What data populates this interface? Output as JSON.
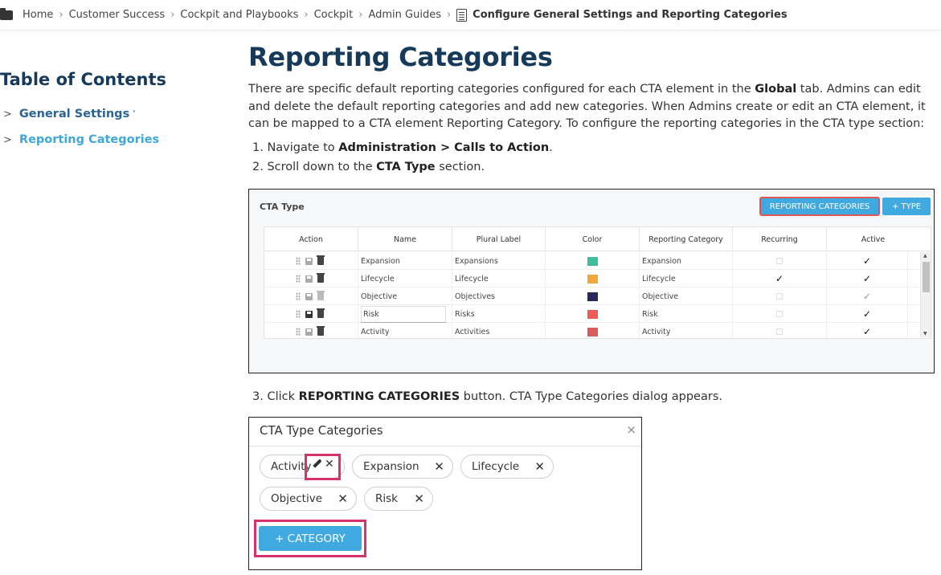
{
  "breadcrumb": {
    "items": [
      "Home",
      "Customer Success",
      "Cockpit and Playbooks",
      "Cockpit",
      "Admin Guides"
    ],
    "current": "Configure General Settings and Reporting Categories"
  },
  "toc": {
    "title": "Table of Contents",
    "items": [
      {
        "label": "General Settings",
        "expandable": true
      },
      {
        "label": "Reporting Categories",
        "active": true
      }
    ]
  },
  "main": {
    "heading": "Reporting Categories",
    "intro_1": "There are specific default reporting categories configured for each CTA element in the ",
    "intro_bold": "Global",
    "intro_2": " tab. Admins can edit and delete the default reporting categories and add new categories. When Admins create or edit an CTA element, it can be mapped to a CTA element Reporting Category. To configure the reporting categories in the CTA type section:",
    "step1_a": "1. Navigate to ",
    "step1_bold": "Administration > Calls to Action",
    "step1_b": ".",
    "step2_a": "2. Scroll down to the ",
    "step2_bold": "CTA Type",
    "step2_b": " section.",
    "step3_a": "3. Click ",
    "step3_bold": "REPORTING CATEGORIES",
    "step3_b": " button. CTA Type Categories dialog appears."
  },
  "cta_type_panel": {
    "title": "CTA Type",
    "reporting_button": "REPORTING CATEGORIES",
    "type_button": "+ TYPE",
    "columns": [
      "Action",
      "Name",
      "Plural Label",
      "Color",
      "Reporting Category",
      "Recurring",
      "Active"
    ],
    "rows": [
      {
        "name": "Expansion",
        "plural": "Expansions",
        "color": "#3dbd9b",
        "category": "Expansion",
        "recurring": false,
        "active": true
      },
      {
        "name": "Lifecycle",
        "plural": "Lifecycle",
        "color": "#f0a83a",
        "category": "Lifecycle",
        "recurring": true,
        "active": true
      },
      {
        "name": "Objective",
        "plural": "Objectives",
        "color": "#28285e",
        "category": "Objective",
        "recurring": false,
        "active": true
      },
      {
        "name": "Risk",
        "plural": "Risks",
        "color": "#ef5a57",
        "category": "Risk",
        "recurring": false,
        "active": true
      },
      {
        "name": "Activity",
        "plural": "Activities",
        "color": "#d95b5b",
        "category": "Activity",
        "recurring": false,
        "active": true
      }
    ]
  },
  "dialog": {
    "title": "CTA Type Categories",
    "close": "×",
    "chips": [
      "Activity",
      "Expansion",
      "Lifecycle",
      "Objective",
      "Risk"
    ],
    "category_button": "+ CATEGORY"
  }
}
